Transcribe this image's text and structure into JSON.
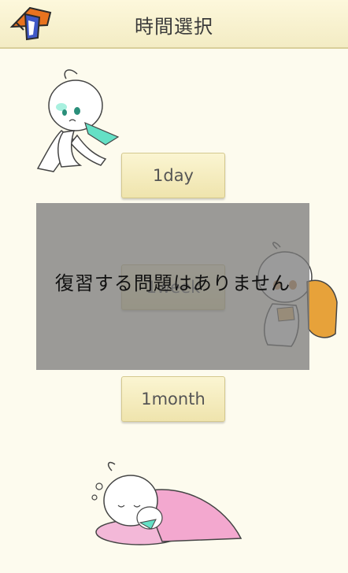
{
  "header": {
    "title": "時間選択",
    "logo_icon": "app-logo-icon"
  },
  "buttons": {
    "day": "1day",
    "week": "1week",
    "month": "1month"
  },
  "overlay": {
    "message": "復習する問題はありません"
  },
  "colors": {
    "background": "#fdfbee",
    "header": "#f6f0cc",
    "button": "#f4ebbd",
    "overlay": "#7a7a7a",
    "mascot_accent": "#64e0c5",
    "pillow": "#f3b8d8",
    "bag": "#e7a23a"
  }
}
